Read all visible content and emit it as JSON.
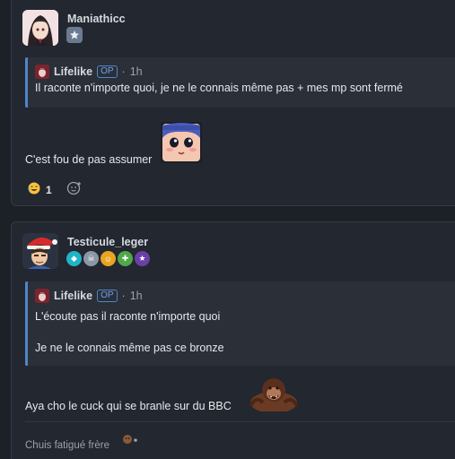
{
  "posts": [
    {
      "author": "Maniathicc",
      "quote": {
        "author": "Lifelike",
        "op_label": "OP",
        "separator": "·",
        "time": "1h",
        "lines": [
          "Il raconte n'importe quoi, je ne le connais même pas + mes mp sont fermé"
        ]
      },
      "message": "C'est fou de pas assumer",
      "reactions": [
        {
          "icon": "laughing-emoji-icon",
          "count": "1"
        }
      ]
    },
    {
      "author": "Testicule_leger",
      "quote": {
        "author": "Lifelike",
        "op_label": "OP",
        "separator": "·",
        "time": "1h",
        "lines": [
          "L'écoute pas il raconte n'importe quoi",
          "Je ne le connais même pas ce bronze"
        ]
      },
      "message": "Aya cho le cuck qui se branle sur du BBC",
      "signature": "Chuis fatigué frère"
    }
  ],
  "colors": {
    "background": "#1c2027",
    "card": "#23272f",
    "quote_bg": "#2a2f38",
    "accent": "#4f86c9"
  }
}
